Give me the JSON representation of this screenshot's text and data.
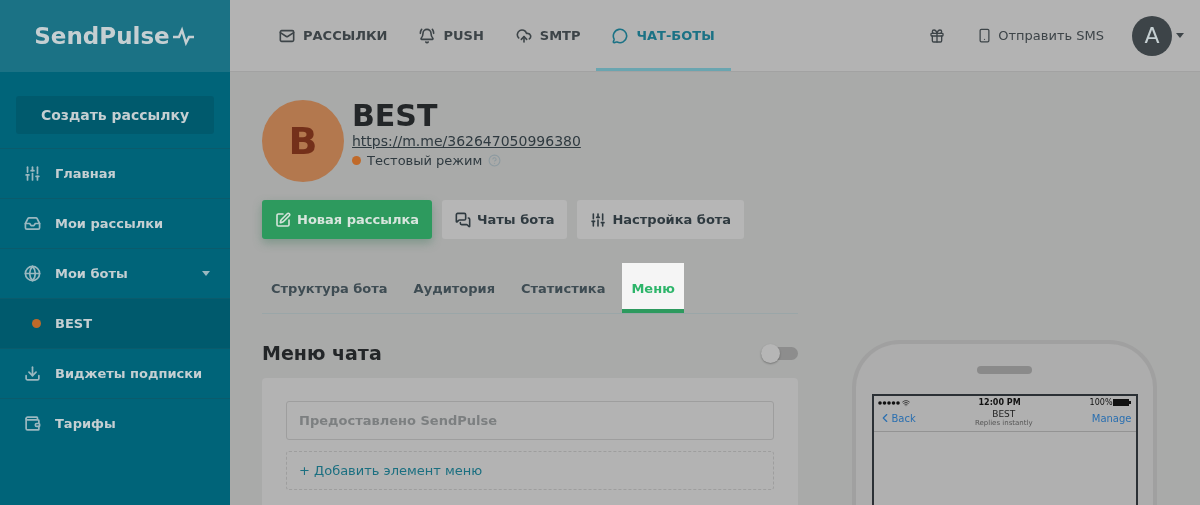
{
  "brand": {
    "name": "SendPulse"
  },
  "topnav": [
    {
      "label": "РАССЫЛКИ",
      "selected": false
    },
    {
      "label": "PUSH",
      "selected": false
    },
    {
      "label": "SMTP",
      "selected": false
    },
    {
      "label": "ЧАТ-БОТЫ",
      "selected": true
    }
  ],
  "send_sms": "Отправить SMS",
  "user": {
    "initial": "A"
  },
  "sidebar": {
    "create_button": "Создать рассылку",
    "items": [
      {
        "label": "Главная",
        "selected": false
      },
      {
        "label": "Мои рассылки",
        "selected": false
      },
      {
        "label": "Мои боты",
        "selected": false,
        "expanded": true,
        "children": [
          {
            "label": "BEST",
            "selected": true
          }
        ]
      },
      {
        "label": "Виджеты подписки",
        "selected": false
      },
      {
        "label": "Тарифы",
        "selected": false
      }
    ]
  },
  "bot": {
    "avatar_letter": "B",
    "name": "BEST",
    "link": "https://m.me/362647050996380",
    "status": "Тестовый режим"
  },
  "actions": [
    {
      "label": "Новая рассылка",
      "kind": "primary"
    },
    {
      "label": "Чаты бота",
      "kind": "secondary"
    },
    {
      "label": "Настройка бота",
      "kind": "secondary"
    }
  ],
  "tabs": [
    {
      "label": "Структура бота",
      "selected": false
    },
    {
      "label": "Аудитория",
      "selected": false
    },
    {
      "label": "Статистика",
      "selected": false
    },
    {
      "label": "Меню",
      "selected": true
    }
  ],
  "chat_menu": {
    "title": "Меню чата",
    "on": false,
    "items": [
      "Предоставлено SendPulse"
    ],
    "add_label": "+ Добавить элемент меню"
  },
  "phone": {
    "time": "12:00 PM",
    "battery": "100%",
    "back": "Back",
    "title": "BEST",
    "subtitle": "Replies instantly",
    "manage": "Manage"
  }
}
